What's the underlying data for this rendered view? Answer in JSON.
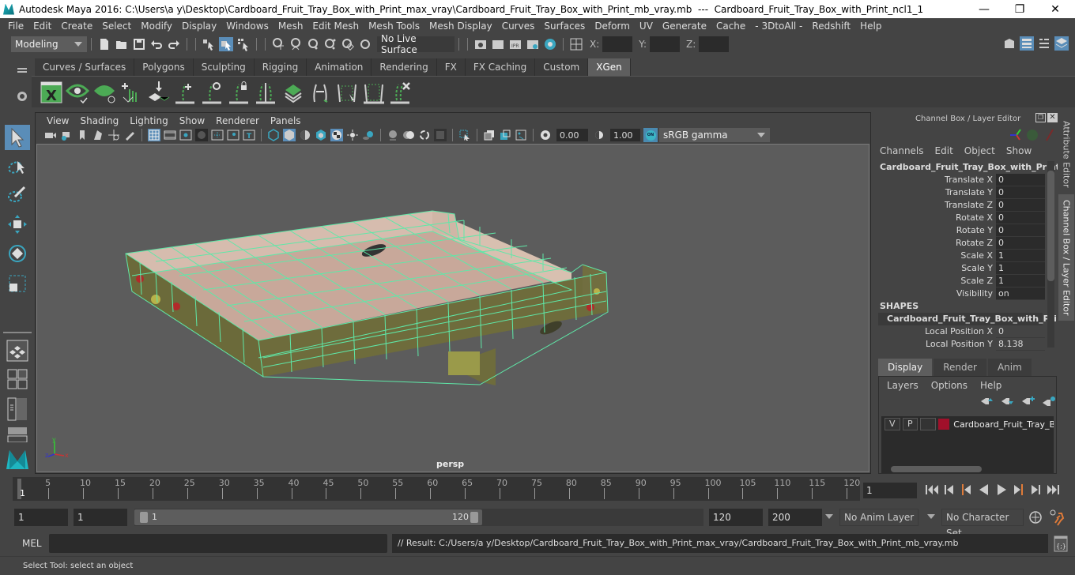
{
  "titlebar": {
    "title": "Autodesk Maya 2016: C:\\Users\\a y\\Desktop\\Cardboard_Fruit_Tray_Box_with_Print_max_vray\\Cardboard_Fruit_Tray_Box_with_Print_mb_vray.mb  ---  Cardboard_Fruit_Tray_Box_with_Print_ncl1_1",
    "minimize": "—",
    "maximize": "❐",
    "close": "✕"
  },
  "menubar": [
    "File",
    "Edit",
    "Create",
    "Select",
    "Modify",
    "Display",
    "Windows",
    "Mesh",
    "Edit Mesh",
    "Mesh Tools",
    "Mesh Display",
    "Curves",
    "Surfaces",
    "Deform",
    "UV",
    "Generate",
    "Cache",
    "- 3DtoAll -",
    "Redshift",
    "Help"
  ],
  "statusline": {
    "mode": "Modeling",
    "live_surface": "No Live Surface",
    "x_label": "X:",
    "y_label": "Y:",
    "z_label": "Z:",
    "x_value": "",
    "y_value": "",
    "z_value": ""
  },
  "shelf": {
    "tabs": [
      "Curves / Surfaces",
      "Polygons",
      "Sculpting",
      "Rigging",
      "Animation",
      "Rendering",
      "FX",
      "FX Caching",
      "Custom",
      "XGen"
    ],
    "active_tab": "XGen",
    "icons": [
      "xgen-window-icon",
      "xgen-preview-icon",
      "xgen-clear-preview-icon",
      "xgen-add-guides-icon",
      "xgen-place-guides-icon",
      "xgen-add-description-icon",
      "xgen-toggle-visibility-icon",
      "xgen-lock-icon",
      "xgen-guides-icon",
      "xgen-grid-icon",
      "xgen-flip-icon",
      "xgen-select-icon",
      "xgen-frame-icon",
      "xgen-delete-icon"
    ]
  },
  "viewport": {
    "menu": [
      "View",
      "Shading",
      "Lighting",
      "Show",
      "Renderer",
      "Panels"
    ],
    "exposure": "0.00",
    "gamma": "1.00",
    "color_space": "sRGB gamma",
    "color_mgmt": "ON",
    "camera_label": "persp",
    "axis": {
      "x": "x",
      "y": "y",
      "z": "z"
    }
  },
  "channelbox": {
    "title": "Channel Box / Layer Editor",
    "menu": [
      "Channels",
      "Edit",
      "Object",
      "Show"
    ],
    "object_name": "Cardboard_Fruit_Tray_Box_with_Print...",
    "channels": [
      {
        "label": "Translate X",
        "value": "0"
      },
      {
        "label": "Translate Y",
        "value": "0"
      },
      {
        "label": "Translate Z",
        "value": "0"
      },
      {
        "label": "Rotate X",
        "value": "0"
      },
      {
        "label": "Rotate Y",
        "value": "0"
      },
      {
        "label": "Rotate Z",
        "value": "0"
      },
      {
        "label": "Scale X",
        "value": "1"
      },
      {
        "label": "Scale Y",
        "value": "1"
      },
      {
        "label": "Scale Z",
        "value": "1"
      },
      {
        "label": "Visibility",
        "value": "on"
      }
    ],
    "shapes_heading": "SHAPES",
    "shape_name": "Cardboard_Fruit_Tray_Box_with_Pri...",
    "shape_channels": [
      {
        "label": "Local Position X",
        "value": "0"
      },
      {
        "label": "Local Position Y",
        "value": "8.138"
      }
    ]
  },
  "layer_editor": {
    "tabs": [
      "Display",
      "Render",
      "Anim"
    ],
    "active_tab": "Display",
    "menu": [
      "Layers",
      "Options",
      "Help"
    ],
    "layers": [
      {
        "v": "V",
        "p": "P",
        "name": "Cardboard_Fruit_Tray_Bo",
        "color": "#a0102a"
      }
    ]
  },
  "sidetabs": [
    "Attribute Editor",
    "Channel Box / Layer Editor"
  ],
  "timeline": {
    "ticks": [
      5,
      10,
      15,
      20,
      25,
      30,
      35,
      40,
      45,
      50,
      55,
      60,
      65,
      70,
      75,
      80,
      85,
      90,
      95,
      100,
      105,
      110,
      115,
      120
    ],
    "current_marker": "1",
    "current_frame": "1"
  },
  "range": {
    "start": "1",
    "playback_start": "1",
    "slider_start": "1",
    "slider_end": "120",
    "playback_end": "120",
    "end": "200",
    "anim_layer": "No Anim Layer",
    "character_set": "No Character Set"
  },
  "command": {
    "mel_label": "MEL",
    "mel_input": "",
    "result": "// Result: C:/Users/a y/Desktop/Cardboard_Fruit_Tray_Box_with_Print_max_vray/Cardboard_Fruit_Tray_Box_with_Print_mb_vray.mb"
  },
  "helpline": "Select Tool: select an object",
  "colors": {
    "accent": "#5a8db8",
    "wireframe": "#5fe8a8",
    "playhead": "#e07b39",
    "layer": "#a0102a"
  }
}
